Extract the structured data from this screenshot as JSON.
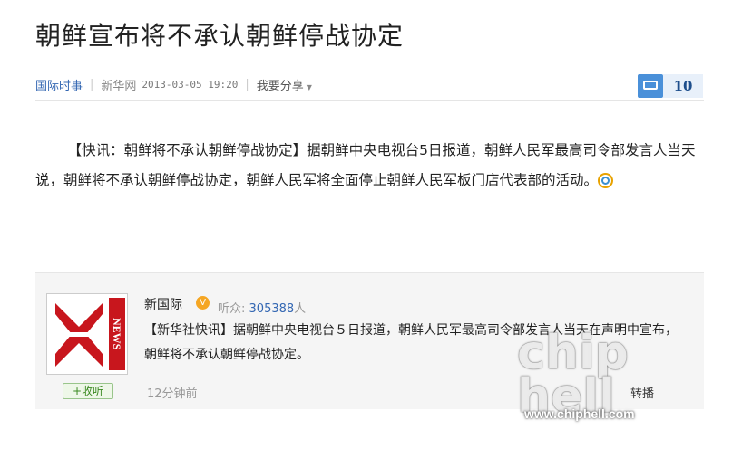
{
  "article": {
    "title": "朝鲜宣布将不承认朝鲜停战协定",
    "category": "国际时事",
    "source": "新华网",
    "datetime": "2013-03-05 19:20",
    "share_label": "我要分享",
    "comment_count": "10",
    "body": "【快讯：朝鲜将不承认朝鲜停战协定】据朝鲜中央电视台5日报道，朝鲜人民军最高司令部发言人当天说，朝鲜将不承认朝鲜停战协定，朝鲜人民军将全面停止朝鲜人民军板门店代表部的活动。"
  },
  "weibo_card": {
    "avatar_text": "NEWS",
    "follow_label": "+收听",
    "name": "新国际",
    "verified_badge": "V",
    "listeners_label": "听众:",
    "listeners_count": "305388",
    "listeners_unit": "人",
    "post_text": "【新华社快讯】据朝鲜中央电视台５日报道，朝鲜人民军最高司令部发言人当天在声明中宣布，朝鲜将不承认朝鲜停战协定。",
    "time_ago": "12分钟前",
    "repost_label": "转播"
  },
  "watermark": {
    "url": "www.chiphell.com",
    "logo_text": "chip hell"
  },
  "colors": {
    "link_blue": "#3568b3",
    "comment_bubble": "#4a90d9",
    "follow_green": "#3b8a22",
    "avatar_red": "#c8161d",
    "verified_orange": "#f5a623"
  }
}
